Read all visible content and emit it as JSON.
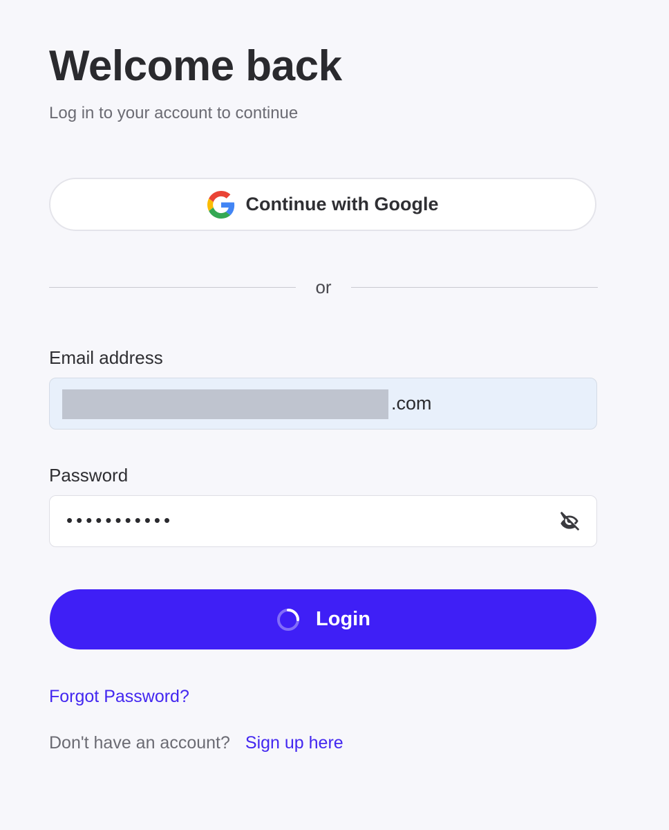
{
  "header": {
    "title": "Welcome back",
    "subtitle": "Log in to your account to continue"
  },
  "google": {
    "label": "Continue with Google",
    "icon": "google-g-icon"
  },
  "divider": {
    "text": "or"
  },
  "email": {
    "label": "Email address",
    "value_suffix": ".com"
  },
  "password": {
    "label": "Password",
    "masked_value": "•••••••••••",
    "toggle_icon": "eye-off-icon"
  },
  "login": {
    "label": "Login",
    "state": "loading"
  },
  "links": {
    "forgot": "Forgot Password?",
    "signup_prompt": "Don't have an account?",
    "signup": "Sign up here"
  },
  "colors": {
    "accent": "#3f1ff6",
    "link": "#4327f0",
    "background": "#f7f7fb",
    "email_fill": "#e8f0fb"
  }
}
